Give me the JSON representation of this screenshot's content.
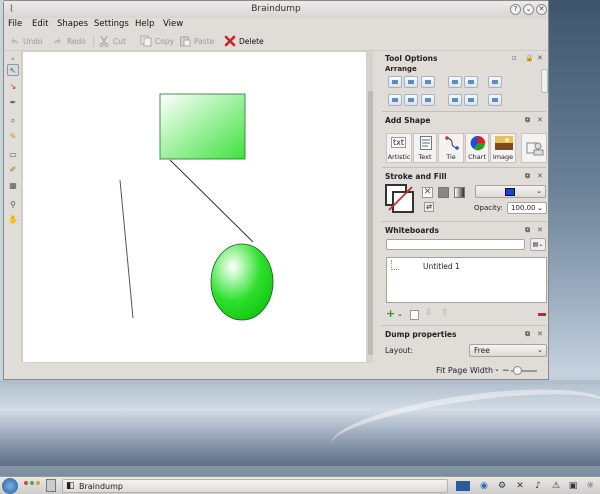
{
  "window": {
    "title": "Braindump",
    "buttons": {
      "help": "?",
      "minimize": "⌄",
      "close": "✕"
    }
  },
  "menu": [
    "File",
    "Edit",
    "Shapes",
    "Settings",
    "Help",
    "View"
  ],
  "toolbar": {
    "undo": "Undo",
    "redo": "Redo",
    "cut": "Cut",
    "copy": "Copy",
    "paste": "Paste",
    "delete": "Delete"
  },
  "panel": {
    "tool_options": "Tool Options",
    "arrange": "Arrange",
    "add_shape": "Add Shape",
    "shapes": [
      "Artistic",
      "Text",
      "Tie",
      "Chart",
      "Image"
    ],
    "artistic_glyph": "txt",
    "stroke_and_fill": "Stroke and Fill",
    "opacity_label": "Opacity:",
    "opacity_value": "100.00",
    "whiteboards": "Whiteboards",
    "whiteboard_items": [
      "Untitled 1"
    ],
    "dump_properties": "Dump properties",
    "layout_label": "Layout:",
    "layout_value": "Free"
  },
  "status": {
    "zoom": "Fit Page Width"
  },
  "taskbar": {
    "entry": "Braindump"
  },
  "colors": {
    "shape_green": "#44e044",
    "fill_blue": "#1a3fe0",
    "delete_red": "#d42020"
  },
  "icons": [
    "undo-icon",
    "redo-icon",
    "cut-icon",
    "copy-icon",
    "paste-icon",
    "delete-icon",
    "kde-menu-icon",
    "network-icon",
    "volume-icon",
    "clock-icon"
  ]
}
